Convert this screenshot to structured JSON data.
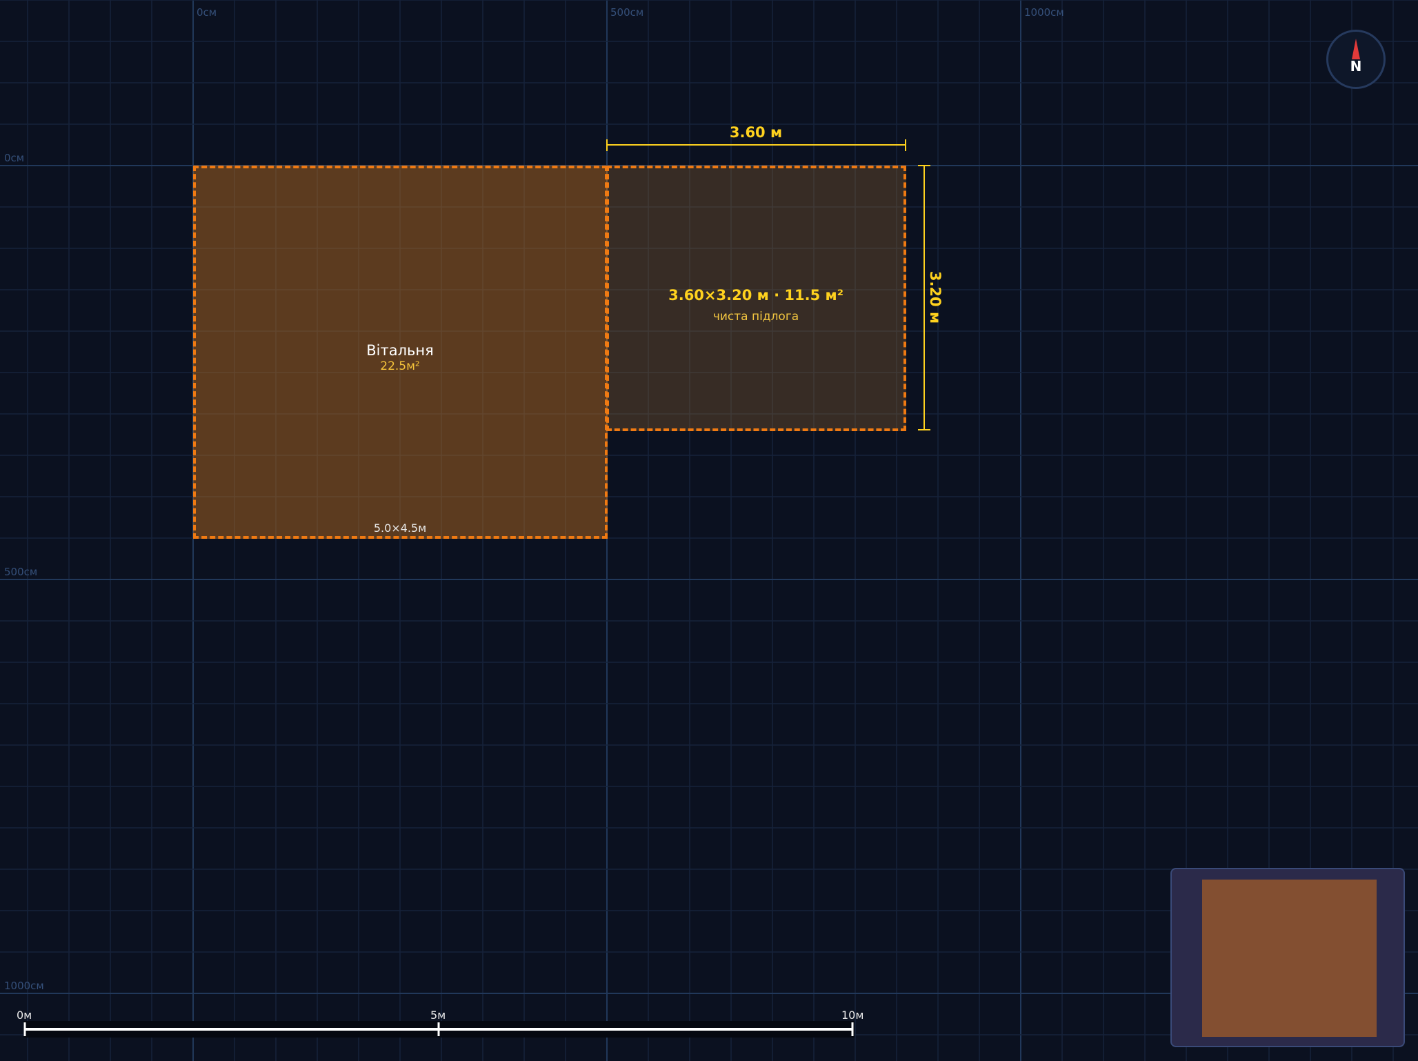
{
  "grid": {
    "x_axis_labels": [
      "0см",
      "500см",
      "1000см"
    ],
    "y_axis_labels": [
      "0см",
      "500см",
      "1000см"
    ]
  },
  "rooms": [
    {
      "name": "Вітальня",
      "area": "22.5м²",
      "dimensions": "5.0×4.5м"
    }
  ],
  "draft_room": {
    "dimensions_area": "3.60×3.20 м · 11.5 м²",
    "subtitle": "чиста підлога",
    "width_label": "3.60 м",
    "height_label": "3.20 м"
  },
  "compass": {
    "label": "N"
  },
  "scale_bar": {
    "labels": [
      "0м",
      "5м",
      "10м"
    ]
  },
  "colors": {
    "background": "#0b1120",
    "grid_minor": "#16233a",
    "grid_major": "#21385a",
    "room_outline": "#f07a12",
    "room_fill": "#7a4a1a",
    "dimension": "#ffd21e",
    "minimap_bg": "#2b2a4a",
    "minimap_room": "#834f31"
  }
}
